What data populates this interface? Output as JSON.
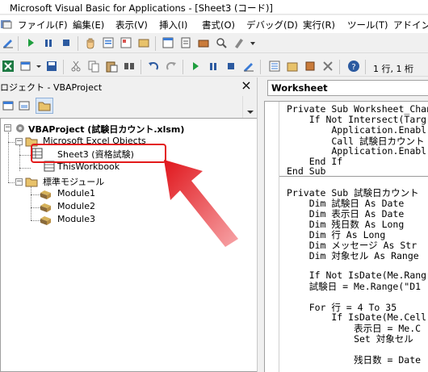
{
  "window": {
    "title": "Microsoft Visual Basic for Applications - [Sheet3 (コード)]"
  },
  "menu": [
    {
      "label": "ファイル(F)"
    },
    {
      "label": "編集(E)"
    },
    {
      "label": "表示(V)"
    },
    {
      "label": "挿入(I)"
    },
    {
      "label": "書式(O)"
    },
    {
      "label": "デバッグ(D)"
    },
    {
      "label": "実行(R)"
    },
    {
      "label": "ツール(T)"
    },
    {
      "label": "アドイン("
    }
  ],
  "status": {
    "position": "1 行, 1 桁"
  },
  "project": {
    "title": "ロジェクト - VBAProject",
    "close_label": "×",
    "root": "VBAProject (試験日カウント.xlsm)",
    "folder_objects": "Microsoft Excel Objects",
    "sheet3": "Sheet3 (資格試験)",
    "thisworkbook": "ThisWorkbook",
    "folder_modules": "標準モジュール",
    "modules": [
      "Module1",
      "Module2",
      "Module3"
    ]
  },
  "code": {
    "object_selector": "Worksheet",
    "lines": [
      "Private Sub Worksheet_Chan",
      "    If Not Intersect(Targ",
      "        Application.Enabl",
      "        Call 試験日カウント",
      "        Application.Enabl",
      "    End If",
      "End Sub",
      "",
      "Private Sub 試験日カウント",
      "    Dim 試験日 As Date",
      "    Dim 表示日 As Date",
      "    Dim 残日数 As Long",
      "    Dim 行 As Long",
      "    Dim メッセージ As Str",
      "    Dim 対象セル As Range",
      "",
      "    If Not IsDate(Me.Rang",
      "    試験日 = Me.Range(\"D1",
      "",
      "    For 行 = 4 To 35",
      "        If IsDate(Me.Cell",
      "            表示日 = Me.C",
      "            Set 対象セル",
      "",
      "            残日数 = Date"
    ]
  }
}
